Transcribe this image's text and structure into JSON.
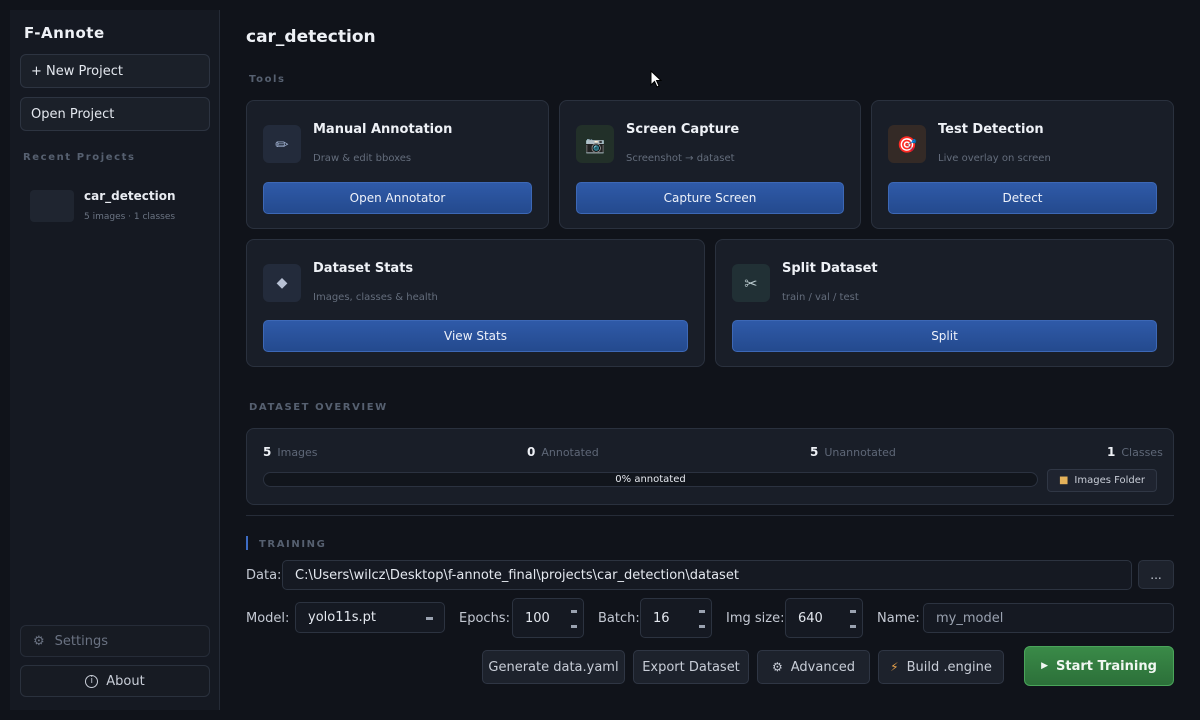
{
  "sidebar": {
    "brand": "F-Annote",
    "new_project": "+ New Project",
    "open_project": "Open Project",
    "recent_label": "Recent Projects",
    "recent": [
      {
        "name": "car_detection",
        "meta": "5 images  ·  1 classes"
      }
    ],
    "settings": "Settings",
    "about": "About"
  },
  "main": {
    "title": "car_detection",
    "tools_label": "Tools",
    "tools": [
      {
        "title": "Manual Annotation",
        "subtitle": "Draw & edit bboxes",
        "action": "Open Annotator",
        "icon": "pencil-icon",
        "glyph": "✏"
      },
      {
        "title": "Screen Capture",
        "subtitle": "Screenshot → dataset",
        "action": "Capture Screen",
        "icon": "camera-icon",
        "glyph": "📷"
      },
      {
        "title": "Test Detection",
        "subtitle": "Live overlay on screen",
        "action": "Detect",
        "icon": "target-icon",
        "glyph": "🎯"
      },
      {
        "title": "Dataset Stats",
        "subtitle": "Images, classes & health",
        "action": "View Stats",
        "icon": "diamond-icon",
        "glyph": "◆"
      },
      {
        "title": "Split Dataset",
        "subtitle": "train / val / test",
        "action": "Split",
        "icon": "scissors-icon",
        "glyph": "✂"
      }
    ],
    "overview_label": "DATASET OVERVIEW",
    "overview": {
      "images_count": "5",
      "images_label": "Images",
      "annotated_count": "0",
      "annotated_label": "Annotated",
      "unannotated_count": "5",
      "unannotated_label": "Unannotated",
      "classes_count": "1",
      "classes_label": "Classes",
      "progress": 0,
      "progress_text": "0%  annotated",
      "folder_button": "Images Folder"
    },
    "training": {
      "label": "TRAINING",
      "data_label": "Data:",
      "data_path": "C:\\Users\\wilcz\\Desktop\\f-annote_final\\projects\\car_detection\\dataset",
      "browse": "...",
      "model_label": "Model:",
      "model_value": "yolo11s.pt",
      "epochs_label": "Epochs:",
      "epochs_value": "100",
      "batch_label": "Batch:",
      "batch_value": "16",
      "imgsize_label": "Img size:",
      "imgsize_value": "640",
      "name_label": "Name:",
      "name_value": "my_model",
      "buttons": {
        "generate": "Generate data.yaml",
        "export": "Export Dataset",
        "advanced": "Advanced",
        "build": "Build .engine",
        "start": "Start Training"
      }
    }
  },
  "colors": {
    "accent": "#2f5aa8",
    "start": "#3a8a48",
    "background": "#10131a"
  }
}
